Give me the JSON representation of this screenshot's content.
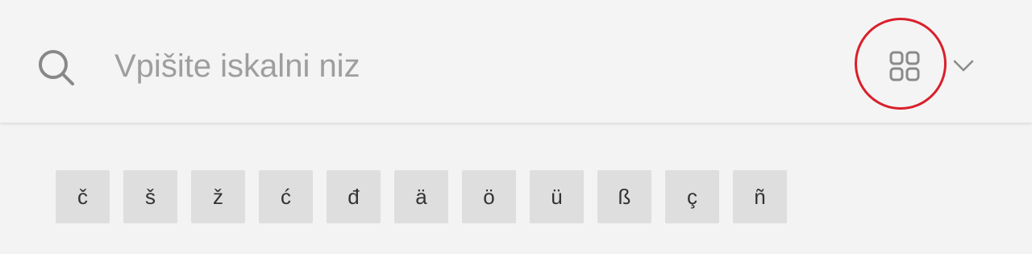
{
  "search": {
    "placeholder": "Vpišite iskalni niz",
    "value": ""
  },
  "icons": {
    "search": "search-icon",
    "grid": "grid-icon",
    "chevron": "chevron-down-icon"
  },
  "colors": {
    "background": "#f4f4f4",
    "key_background": "#dedede",
    "highlight_ring": "#d9202b",
    "placeholder": "#9e9e9e"
  },
  "special_characters": [
    "č",
    "š",
    "ž",
    "ć",
    "đ",
    "ä",
    "ö",
    "ü",
    "ß",
    "ç",
    "ñ"
  ]
}
